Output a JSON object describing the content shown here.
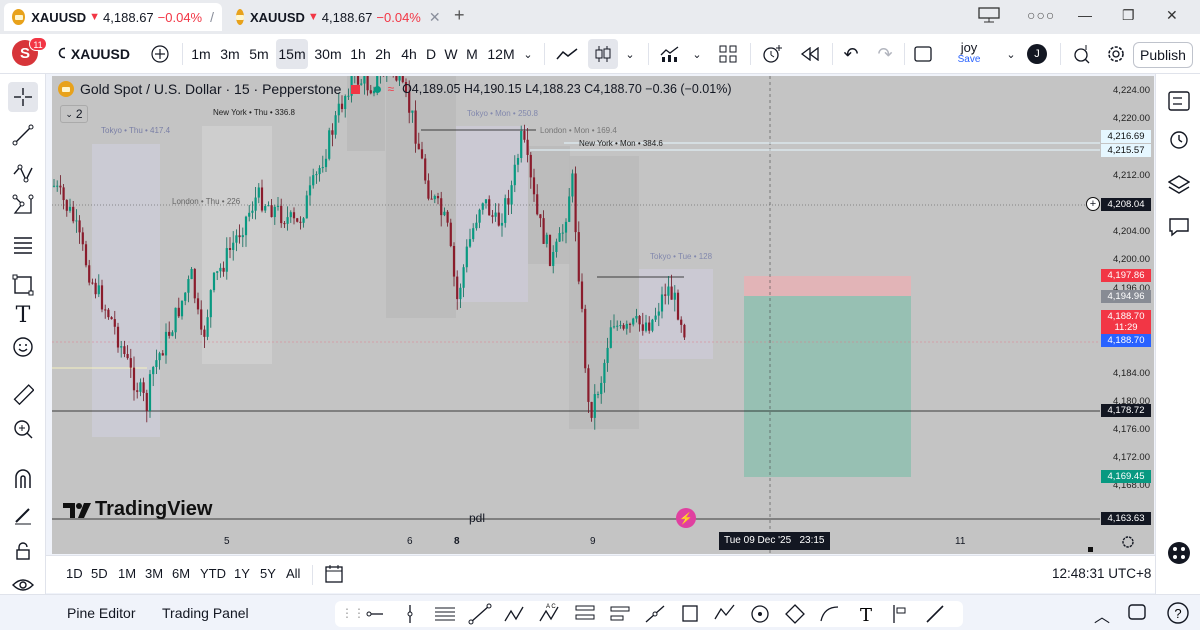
{
  "tabs": [
    {
      "symbol": "XAUUSD",
      "price": "4,188.67",
      "change": "−0.04%"
    },
    {
      "symbol": "XAUUSD",
      "price": "4,188.67",
      "change": "−0.04%"
    }
  ],
  "toolbar": {
    "avatar_letter": "S",
    "notif_count": "11",
    "symbol": "XAUUSD",
    "intervals": [
      "1m",
      "3m",
      "5m",
      "15m",
      "30m",
      "1h",
      "2h",
      "4h",
      "D",
      "W",
      "M",
      "12M"
    ],
    "selected_interval": "15m",
    "user": "joy",
    "save_label": "Save",
    "user_initial": "J",
    "publish_label": "Publish"
  },
  "legend": {
    "title": "Gold Spot / U.S. Dollar · 15 · Pepperstone",
    "ohlc": "O4,189.05 H4,190.15 L4,188.23 C4,188.70 −0.36 (−0.01%)",
    "indicator_count": "2"
  },
  "sessions": {
    "tokyo_thu": "Tokyo • Thu • 417.4",
    "newyork_thu": "New York • Thu • 336.8",
    "london_thu": "London • Thu • 226",
    "tokyo_mon": "Tokyo • Mon • 250.8",
    "london_mon": "London • Mon • 169.4",
    "newyork_mon": "New York • Mon • 384.6",
    "tokyo_tue": "Tokyo • Tue • 128"
  },
  "price_axis": {
    "ticks": [
      "4,224.00",
      "4,220.00",
      "4,212.00",
      "4,204.00",
      "4,200.00",
      "4,196.00",
      "4,184.00",
      "4,180.00",
      "4,176.00",
      "4,172.00",
      "4,168.00"
    ],
    "tags": {
      "t1": "4,216.69",
      "t2": "4,215.57",
      "crosshair": "4,208.04",
      "stop": "4,197.86",
      "entry": "4,194.96",
      "last": "4,188.70",
      "countdown": "11:29",
      "bid": "4,188.70",
      "line": "4,178.72",
      "target": "4,169.45",
      "pdl": "4,163.63"
    }
  },
  "time_axis": {
    "labels": [
      "5",
      "6",
      "8",
      "9",
      "11"
    ],
    "crosshair": "Tue 09 Dec '25   23:15"
  },
  "chart_labels": {
    "pdl": "pdl",
    "watermark": "TradingView"
  },
  "ranges": [
    "1D",
    "5D",
    "1M",
    "3M",
    "6M",
    "YTD",
    "1Y",
    "5Y",
    "All"
  ],
  "clock": "12:48:31 UTC+8",
  "bottom": {
    "pine_editor": "Pine Editor",
    "trading_panel": "Trading Panel"
  },
  "colors": {
    "down": "#f23645",
    "up": "#089981",
    "stop_zone": "#e8b2b5",
    "target_zone": "#8fbfb0",
    "tag_blue": "#2962ff"
  }
}
